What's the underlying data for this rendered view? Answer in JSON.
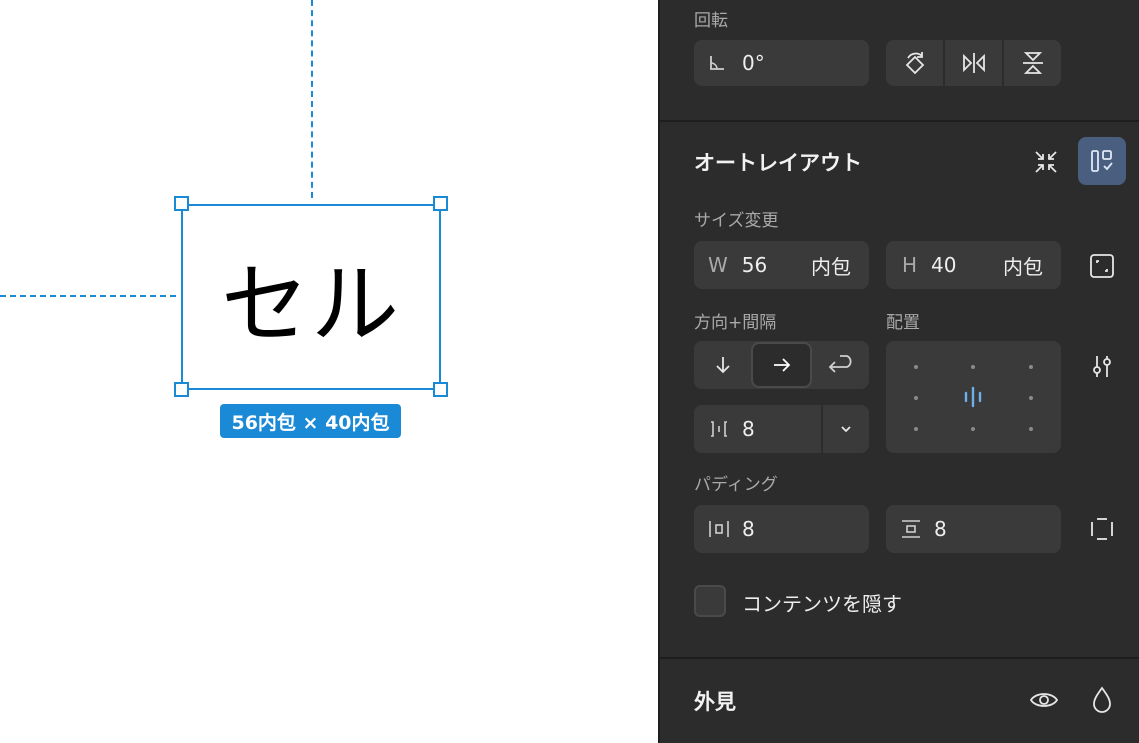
{
  "canvas": {
    "frame_text": "セル",
    "size_badge": "56内包 × 40内包"
  },
  "panel": {
    "rotation": {
      "label": "回転",
      "value": "0°"
    },
    "auto_layout": {
      "heading": "オートレイアウト",
      "size_label": "サイズ変更",
      "width": {
        "prefix": "W",
        "value": "56",
        "mode": "内包"
      },
      "height": {
        "prefix": "H",
        "value": "40",
        "mode": "内包"
      },
      "direction_label": "方向+間隔",
      "alignment_label": "配置",
      "gap_value": "8",
      "padding_label": "パディング",
      "padding_horizontal": "8",
      "padding_vertical": "8",
      "clip_content_label": "コンテンツを隠す"
    },
    "appearance": {
      "heading": "外見"
    },
    "colors": {
      "accent": "#1b8ad6",
      "panel_bg": "#2c2c2c",
      "field_bg": "#3a3a3a",
      "active_toggle": "#4a5f80"
    }
  }
}
